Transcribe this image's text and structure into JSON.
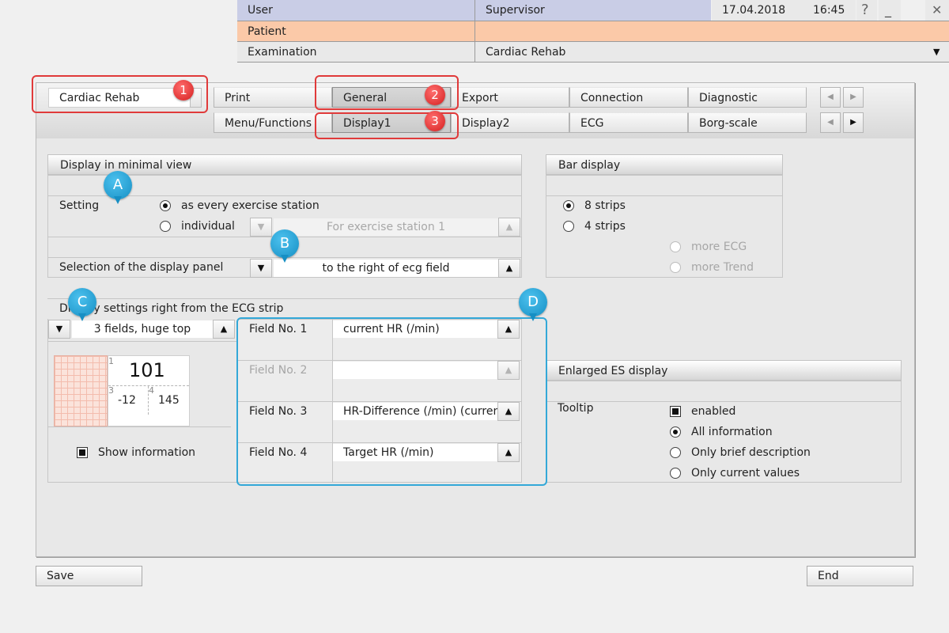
{
  "header": {
    "user_label": "User",
    "user_value": "Supervisor",
    "date": "17.04.2018",
    "time": "16:45",
    "help": "?",
    "minimize": "_",
    "close": "✕",
    "patient_label": "Patient",
    "patient_value": "",
    "exam_label": "Examination",
    "exam_value": "Cardiac Rehab",
    "dropdown_glyph": "▼"
  },
  "program_select": {
    "value": "Cardiac Rehab"
  },
  "tabs_row1": [
    "Print",
    "General",
    "Export",
    "Connection",
    "Diagnostic"
  ],
  "tabs_row2": [
    "Menu/Functions",
    "Display1",
    "Display2",
    "ECG",
    "Borg-scale"
  ],
  "callouts": {
    "red": [
      "1",
      "2",
      "3"
    ],
    "blue": [
      "A",
      "B",
      "C",
      "D"
    ]
  },
  "minimal_view": {
    "title": "Display in minimal view",
    "setting_label": "Setting",
    "option_every": "as every exercise station",
    "option_individual": "individual",
    "station_placeholder": "For exercise station 1",
    "selected": "as every exercise station",
    "panel_label": "Selection of the display panel",
    "panel_value": "to the right of ecg field"
  },
  "ecg_settings": {
    "title": "Display settings right from the ECG strip",
    "layout_value": "3 fields, huge top",
    "preview": {
      "n1": "1",
      "big": "101",
      "n3": "3",
      "n4": "4",
      "v3": "-12",
      "v4": "145"
    },
    "show_info_label": "Show information",
    "show_info_checked": true,
    "fields": [
      {
        "label": "Field No. 1",
        "value": "current HR (/min)",
        "enabled": true
      },
      {
        "label": "Field No. 2",
        "value": "",
        "enabled": false
      },
      {
        "label": "Field No. 3",
        "value": "HR-Difference (/min) (current",
        "enabled": true
      },
      {
        "label": "Field No. 4",
        "value": "Target HR (/min)",
        "enabled": true
      }
    ]
  },
  "bar_display": {
    "title": "Bar display",
    "option_8": "8 strips",
    "option_4": "4 strips",
    "more_ecg": "more ECG",
    "more_trend": "more Trend",
    "selected": "8 strips"
  },
  "enlarged_es": {
    "title": "Enlarged ES display",
    "tooltip_label": "Tooltip",
    "enabled_label": "enabled",
    "enabled_checked": true,
    "options": [
      "All information",
      "Only brief description",
      "Only current values"
    ],
    "selected": "All information"
  },
  "footer": {
    "save": "Save",
    "end": "End"
  }
}
